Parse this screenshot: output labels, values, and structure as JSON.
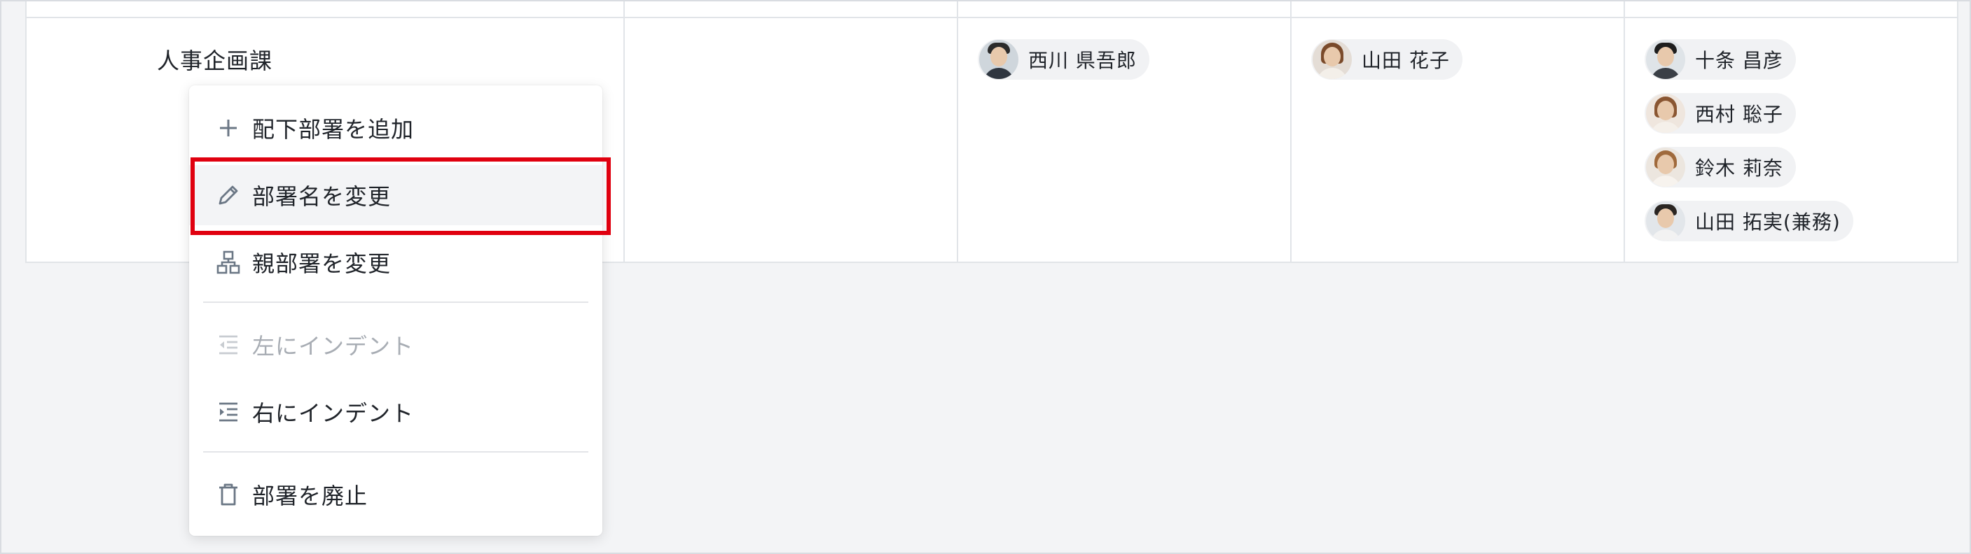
{
  "table": {
    "department_name": "人事企画課",
    "people": {
      "col1": [
        {
          "name": "西川 県吾郎"
        }
      ],
      "col2": [
        {
          "name": "山田 花子"
        }
      ],
      "col3": [
        {
          "name": "十条 昌彦"
        },
        {
          "name": "西村 聡子"
        },
        {
          "name": "鈴木 莉奈"
        },
        {
          "name": "山田 拓実(兼務)"
        }
      ]
    }
  },
  "context_menu": {
    "items": [
      {
        "label": "配下部署を追加",
        "icon": "plus-icon",
        "state": "normal"
      },
      {
        "label": "部署名を変更",
        "icon": "pencil-icon",
        "state": "hovered"
      },
      {
        "label": "親部署を変更",
        "icon": "hierarchy-icon",
        "state": "normal"
      },
      {
        "label": "左にインデント",
        "icon": "outdent-icon",
        "state": "disabled"
      },
      {
        "label": "右にインデント",
        "icon": "indent-icon",
        "state": "normal"
      },
      {
        "label": "部署を廃止",
        "icon": "trash-icon",
        "state": "normal"
      }
    ]
  },
  "colors": {
    "highlight_border": "#e0000f",
    "icon_gray": "#6b7785",
    "disabled_gray": "#a8adb4"
  }
}
